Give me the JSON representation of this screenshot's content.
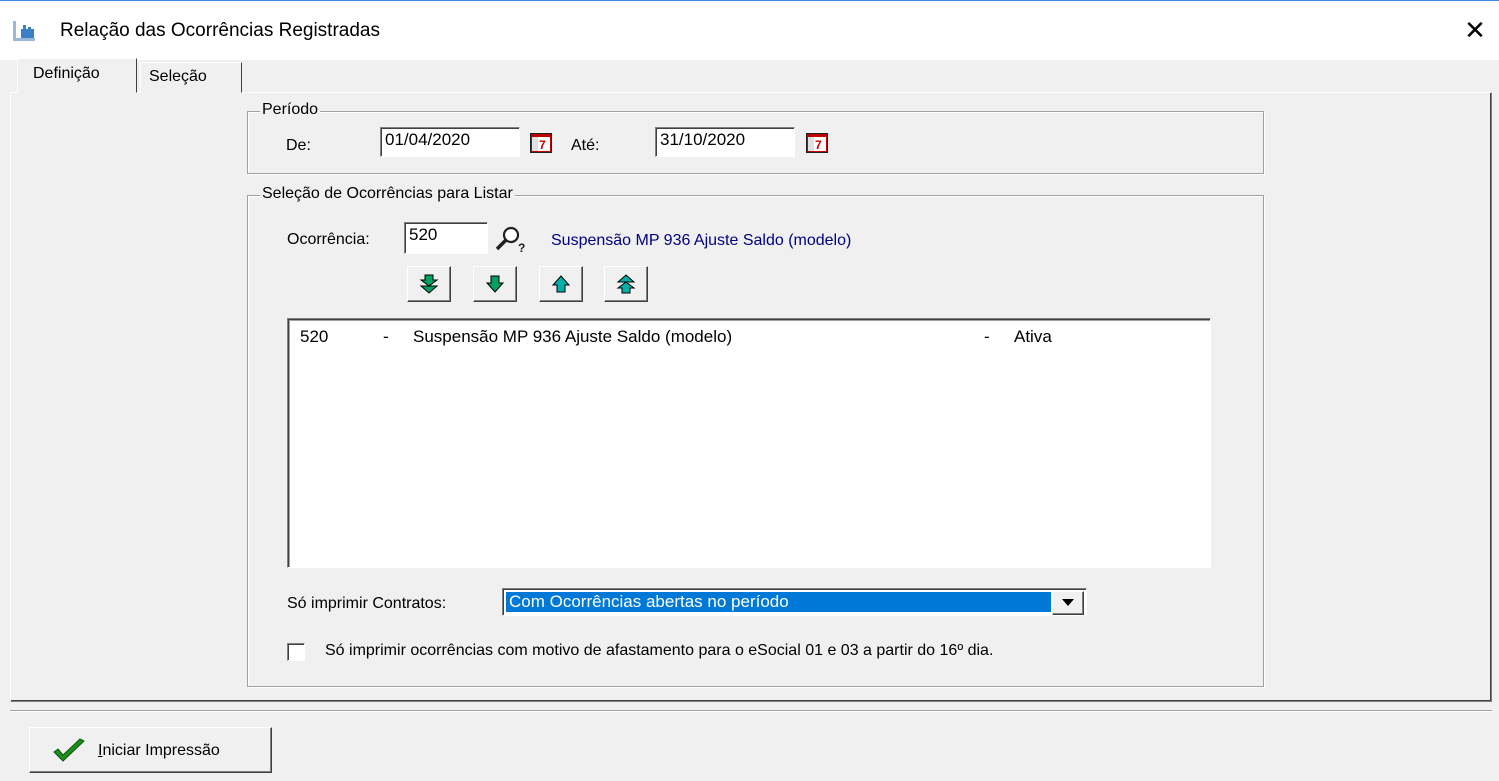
{
  "window": {
    "title": "Relação das Ocorrências Registradas",
    "close_symbol": "✕",
    "icon": "report-window-icon"
  },
  "tabs": [
    {
      "label": "Definição",
      "active": true
    },
    {
      "label": "Seleção",
      "active": false
    }
  ],
  "periodo": {
    "legend": "Período",
    "de_label": "De:",
    "de_value": "01/04/2020",
    "ate_label": "Até:",
    "ate_value": "31/10/2020",
    "calendar_icon": "calendar-icon"
  },
  "selecao": {
    "legend": "Seleção de Ocorrências para Listar",
    "ocorrencia_label": "Ocorrência:",
    "ocorrencia_value": "520",
    "ocorrencia_desc": "Suspensão MP 936 Ajuste Saldo (modelo)",
    "nav_buttons": [
      "move-all-down",
      "move-down",
      "move-up",
      "move-all-up"
    ],
    "list": [
      {
        "code": "520",
        "sep1": "-",
        "desc": "Suspensão MP 936 Ajuste Saldo (modelo)",
        "sep2": "-",
        "status": "Ativa"
      }
    ],
    "contratos_label": "Só imprimir Contratos:",
    "contratos_value": "Com Ocorrências abertas no período",
    "checkbox_label": "Só imprimir ocorrências com motivo de afastamento para o eSocial 01 e 03 a partir do 16º dia.",
    "checkbox_checked": false
  },
  "footer": {
    "print_button_label": "Iniciar Impressão",
    "print_button_mnemonic": "I"
  },
  "colors": {
    "accent_link": "#000080",
    "selection": "#0078d7",
    "arrow_green": "#00a060",
    "arrow_teal": "#00b0a8",
    "check_green": "#1e8c1e"
  }
}
